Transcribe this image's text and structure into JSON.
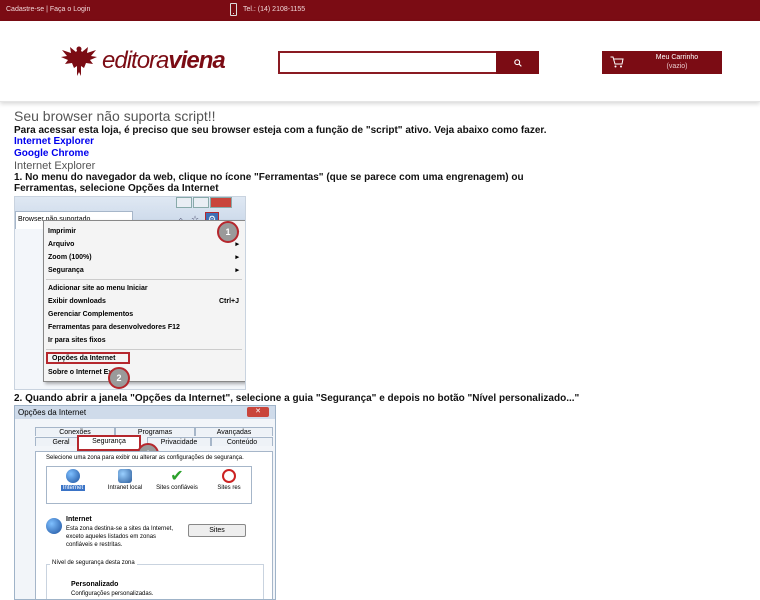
{
  "topbar": {
    "register": "Cadastre-se",
    "divider": "|",
    "login": "Faça o Login",
    "phone": "Tel.: (14) 2108-1155"
  },
  "brand": {
    "logo_prefix": "editora",
    "logo_suffix": "viena"
  },
  "search": {
    "value": "",
    "placeholder": "",
    "icon": "search-icon"
  },
  "cart": {
    "title": "Meu Carrinho",
    "status": "(vazio)",
    "icon": "cart-icon"
  },
  "content": {
    "heading": "Seu browser não suporta script!!",
    "intro": "Para acessar esta loja, é preciso que seu browser esteja com a função de \"script\" ativo. Veja abaixo como fazer.",
    "links": [
      "Internet Explorer",
      "Google Chrome"
    ],
    "section": "Internet Explorer",
    "step1": "1. No menu do navegador da web, clique no ícone \"Ferramentas\" (que se parece com uma engrenagem) ou Ferramentas, selecione Opções da Internet",
    "step2_prefix": "2. Quando abrir a janela ",
    "step2_b1": "\"Opções da Internet\"",
    "step2_mid": ", selecione a guia ",
    "step2_b2": "\"Segurança\"",
    "step2_suffix": " e depois no botão \"Nível personalizado...\""
  },
  "ie_menu": {
    "tab": "Browser não suportado",
    "items": [
      "Imprimir",
      "Arquivo",
      "Zoom (100%)",
      "Segurança",
      "Adicionar site ao menu Iniciar",
      "Exibir downloads",
      "Gerenciar Complementos",
      "Ferramentas para desenvolvedores F12",
      "Ir para sites fixos",
      "Opções da Internet",
      "Sobre o Internet Ex"
    ],
    "shortcut": "Ctrl+J",
    "markers": [
      "1",
      "2"
    ]
  },
  "dialog": {
    "title": "Opções da Internet",
    "tabs_row1": [
      "Conexões",
      "Programas",
      "Avançadas"
    ],
    "tabs_row2": [
      "Geral",
      "Segurança",
      "Privacidade",
      "Conteúdo"
    ],
    "marker": "1",
    "zone_prompt": "Selecione uma zona para exibir ou alterar as configurações de segurança.",
    "zones": [
      "Internet",
      "Intranet local",
      "Sites confiáveis",
      "Sites res"
    ],
    "zone_title": "Internet",
    "zone_desc": "Esta zona destina-se a sites da Internet, exceto aqueles listados em zonas confiáveis e restritas.",
    "sites_button": "Sites",
    "level_label": "Nível de segurança desta zona",
    "level_name": "Personalizado",
    "level_desc": "Configurações personalizadas."
  },
  "colors": {
    "brand": "#7b0c14"
  }
}
